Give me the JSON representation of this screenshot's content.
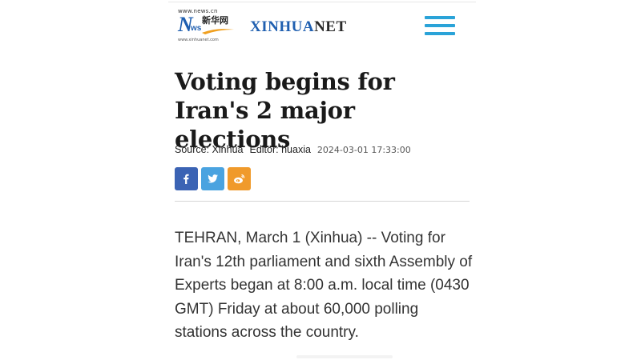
{
  "header": {
    "logo": {
      "url_top": "www.news.cn",
      "news_n": "N",
      "news_ws": "ws",
      "chinese": "新华网",
      "url_bottom": "www.xinhuanet.com"
    },
    "brand_part1": "XINHUA",
    "brand_part2": "NET",
    "menu_icon": "hamburger-menu-icon",
    "accent_color": "#2aa3d8"
  },
  "article": {
    "title": "Voting begins for Iran's 2 major elections",
    "source": "Source: Xinhua",
    "editor": "Editor: huaxia",
    "date": "2024-03-01 17:33:00",
    "share": [
      {
        "icon": "facebook-icon",
        "color": "#3b63b4"
      },
      {
        "icon": "twitter-icon",
        "color": "#4aa3e0"
      },
      {
        "icon": "weibo-icon",
        "color": "#f09a2b"
      }
    ],
    "body": "TEHRAN, March 1 (Xinhua) -- Voting for Iran's 12th parliament and sixth Assembly of Experts began at 8:00 a.m. local time (0430 GMT) Friday at about 60,000 polling stations across the country."
  }
}
